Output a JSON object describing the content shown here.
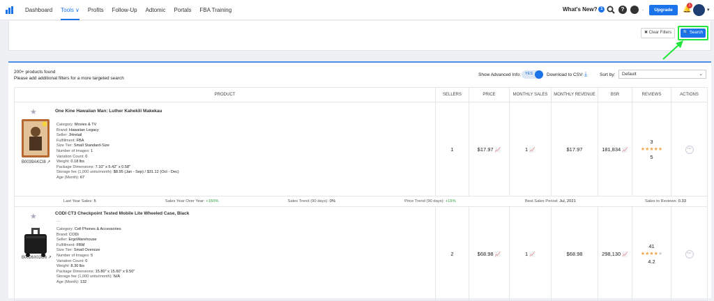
{
  "nav": {
    "links": [
      "Dashboard",
      "Tools ∨",
      "Profits",
      "Follow-Up",
      "Adtomic",
      "Portals",
      "FBA Training"
    ],
    "whats_new": "What's New?",
    "whats_new_count": "1",
    "upgrade": "Upgrade",
    "notif_count": "1"
  },
  "filters": {
    "clear": "✖ Clear Filters",
    "search": "🔍 Search"
  },
  "results": {
    "count": "200+ products found",
    "hint": "Please add additional filters for a more targeted search",
    "adv_label": "Show Advanced Info:",
    "adv_value": "YES",
    "download": "Download to CSV:",
    "sort_label": "Sort by:",
    "sort_value": "Default"
  },
  "columns": [
    "PRODUCT",
    "SELLERS",
    "PRICE",
    "MONTHLY SALES",
    "MONTHLY REVENUE",
    "BSR",
    "REVIEWS",
    "ACTIONS"
  ],
  "products": [
    {
      "title": "One Kine Hawaiian Man: Luther Kahekili Makekau",
      "asin": "B0039AKCI8",
      "attrs": [
        [
          "Category: ",
          "Movies & TV"
        ],
        [
          "Brand: ",
          "Hawaiian Legacy"
        ],
        [
          "Seller: ",
          "JHretail"
        ],
        [
          "Fulfillment: ",
          "FBA"
        ],
        [
          "Size Tier: ",
          "Small Standard-Size"
        ],
        [
          "Number of Images: ",
          "1"
        ],
        [
          "Variation Count: ",
          "0"
        ],
        [
          "Weight: ",
          "0.18 lbs"
        ],
        [
          "Package Dimensions: ",
          "7.10\" x 5.42\" x 0.58\""
        ],
        [
          "Storage fee (1,000 units/month): ",
          "$8.95 (Jan - Sep) / $31.12 (Oct - Dec)"
        ],
        [
          "Age (Month): ",
          "67"
        ]
      ],
      "sellers": "1",
      "price": "$17.97",
      "monthly_sales": "1",
      "monthly_revenue": "$17.97",
      "bsr": "181,834",
      "reviews": "3",
      "rating": "5",
      "rating_value": 5,
      "summary": {
        "last_year": "Last Year Sales: ",
        "last_year_v": "5",
        "yoy": "Sales Year Over Year: ",
        "yoy_v": "+150%",
        "trend": "Sales Trend (90 days): ",
        "trend_v": "0%",
        "price_trend": "Price Trend (90 days): ",
        "price_trend_v": "+15%",
        "best": "Best Sales Period: ",
        "best_v": "Jul, 2021",
        "ratio": "Sales to Reviews: ",
        "ratio_v": "0.33"
      }
    },
    {
      "title": "CODI CT3 Checkpoint Tested Mobile Lite Wheeled Case, Black",
      "asin": "B0026X02G6",
      "attrs": [
        [
          "Category: ",
          "Cell Phones & Accessories"
        ],
        [
          "Brand: ",
          "CODi"
        ],
        [
          "Seller: ",
          "ErgoWarehouse"
        ],
        [
          "Fulfillment: ",
          "FBM"
        ],
        [
          "Size Tier: ",
          "Small Oversize"
        ],
        [
          "Number of Images: ",
          "5"
        ],
        [
          "Variation Count: ",
          "0"
        ],
        [
          "Weight: ",
          "8.30 lbs"
        ],
        [
          "Package Dimensions: ",
          "15.80\" x 15.60\" x 9.50\""
        ],
        [
          "Storage fee (1,000 units/month): ",
          "N/A"
        ],
        [
          "Age (Month): ",
          "132"
        ]
      ],
      "sellers": "2",
      "price": "$68.98",
      "monthly_sales": "1",
      "monthly_revenue": "$68.98",
      "bsr": "298,130",
      "reviews": "41",
      "rating": "4.2",
      "rating_value": 4.2
    }
  ],
  "colors": {
    "accent": "#1a73e8",
    "highlight": "#1ee63a",
    "star": "#f0a64a",
    "positive": "#2e9e3f"
  }
}
